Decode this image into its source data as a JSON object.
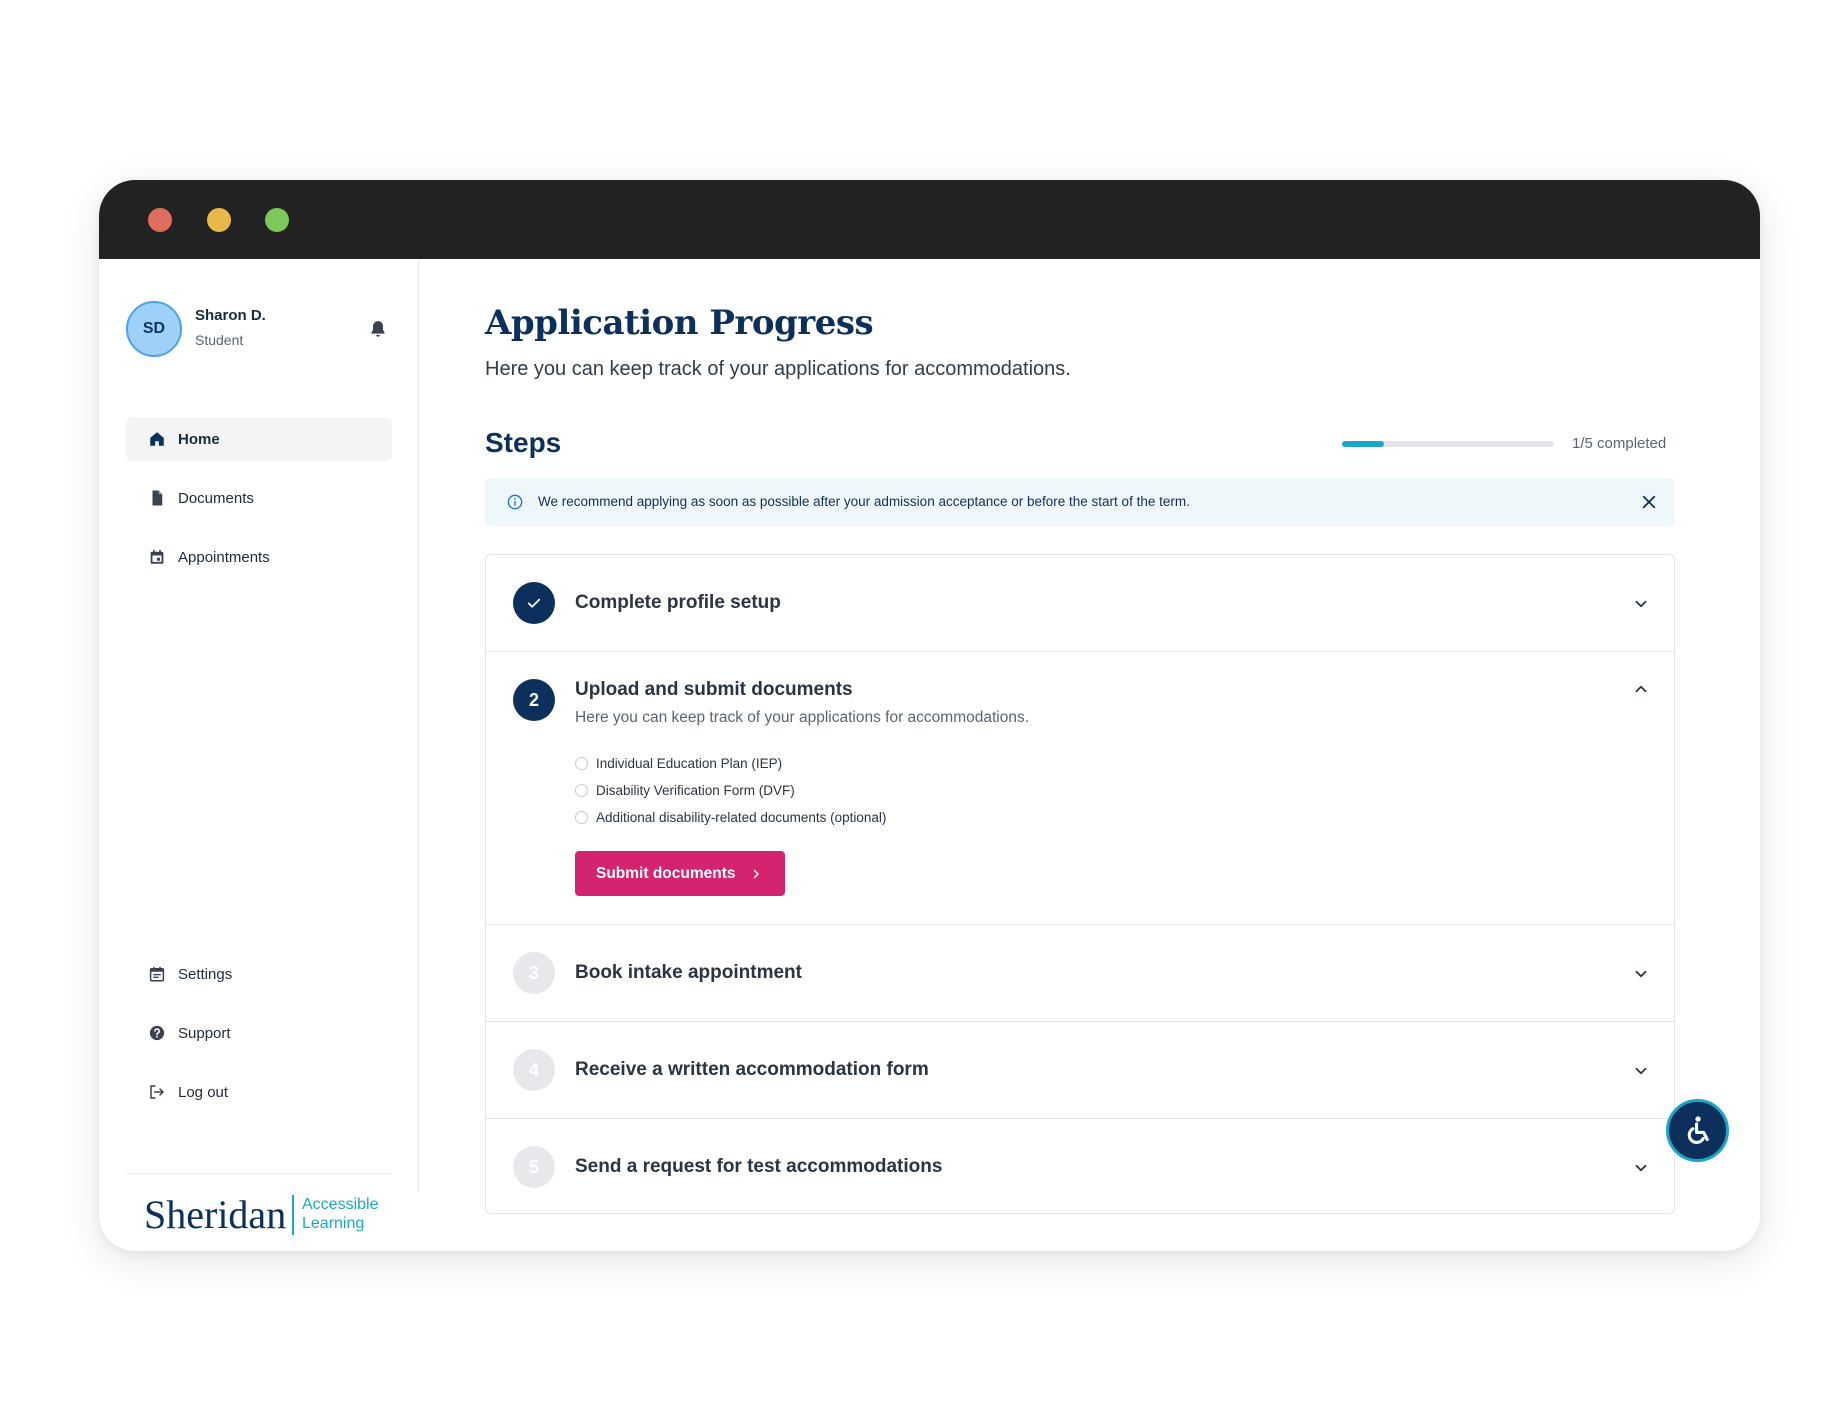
{
  "user": {
    "initials": "SD",
    "name": "Sharon D.",
    "role": "Student"
  },
  "nav": {
    "items": [
      {
        "label": "Home",
        "icon": "home-icon"
      },
      {
        "label": "Documents",
        "icon": "document-icon"
      },
      {
        "label": "Appointments",
        "icon": "calendar-icon"
      }
    ],
    "bottom_items": [
      {
        "label": "Settings",
        "icon": "settings-icon"
      },
      {
        "label": "Support",
        "icon": "help-icon"
      },
      {
        "label": "Log out",
        "icon": "logout-icon"
      }
    ]
  },
  "brand": {
    "name": "Sheridan",
    "tag_line1": "Accessible",
    "tag_line2": "Learning",
    "color": "#0c2f5c",
    "accent": "#1aa7c7"
  },
  "page": {
    "title": "Application Progress",
    "subtitle": "Here you can keep track of your applications for accommodations."
  },
  "steps": {
    "heading": "Steps",
    "progress_label": "1/5 completed",
    "progress_value": 0.2,
    "banner": "We recommend applying as soon as possible after your admission acceptance or before the start of the term.",
    "items": [
      {
        "number": "1",
        "title": "Complete profile setup",
        "status": "done"
      },
      {
        "number": "2",
        "title": "Upload and submit documents",
        "status": "current",
        "description": "Here you can keep track of your applications for accommodations.",
        "documents": [
          "Individual Education Plan (IEP)",
          "Disability Verification Form (DVF)",
          "Additional disability-related documents (optional)"
        ],
        "button": "Submit documents"
      },
      {
        "number": "3",
        "title": "Book intake appointment",
        "status": "todo"
      },
      {
        "number": "4",
        "title": "Receive a written accommodation form",
        "status": "todo"
      },
      {
        "number": "5",
        "title": "Send a request for test accommodations",
        "status": "todo"
      }
    ]
  },
  "colors": {
    "primary": "#0c2f5c",
    "cta": "#d4246f",
    "accent": "#1aa7c7"
  }
}
